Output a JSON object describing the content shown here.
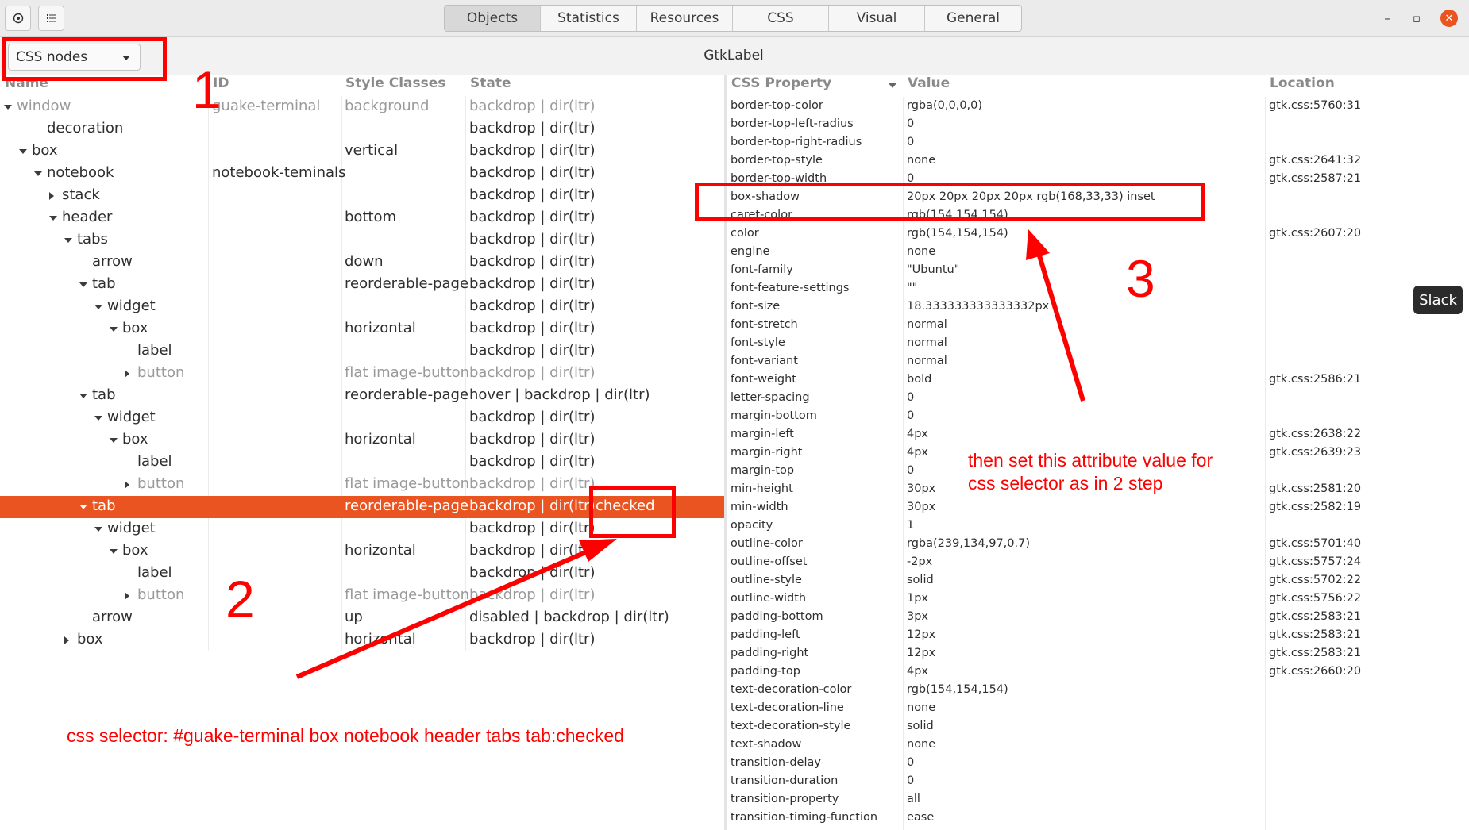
{
  "headerbar": {
    "tabs": [
      {
        "label": "Objects",
        "active": true
      },
      {
        "label": "Statistics",
        "active": false
      },
      {
        "label": "Resources",
        "active": false
      },
      {
        "label": "CSS",
        "active": false
      },
      {
        "label": "Visual",
        "active": false
      },
      {
        "label": "General",
        "active": false
      }
    ],
    "left_buttons": [
      "target-icon",
      "list-icon"
    ],
    "window_controls": [
      "minimize",
      "maximize",
      "close"
    ]
  },
  "subbar": {
    "mode_combo": "CSS nodes",
    "object_title": "GtkLabel"
  },
  "node_tree": {
    "columns": [
      "Name",
      "ID",
      "Style Classes",
      "State"
    ],
    "rows": [
      {
        "name": "window",
        "id": "guake-terminal",
        "classes": "background",
        "state": "backdrop | dir(ltr)",
        "extra": "",
        "expander": "open",
        "dim": true,
        "selected": false
      },
      {
        "name": "decoration",
        "id": "",
        "classes": "",
        "state": "backdrop | dir(ltr)",
        "extra": "",
        "expander": "none",
        "dim": false,
        "selected": false
      },
      {
        "name": "box",
        "id": "",
        "classes": "vertical",
        "state": "backdrop | dir(ltr)",
        "extra": "",
        "expander": "open",
        "dim": false,
        "selected": false
      },
      {
        "name": "notebook",
        "id": "notebook-teminals",
        "classes": "",
        "state": "backdrop | dir(ltr)",
        "extra": "",
        "expander": "open",
        "dim": false,
        "selected": false
      },
      {
        "name": "stack",
        "id": "",
        "classes": "",
        "state": "backdrop | dir(ltr)",
        "extra": "",
        "expander": "closed",
        "dim": false,
        "selected": false
      },
      {
        "name": "header",
        "id": "",
        "classes": "bottom",
        "state": "backdrop | dir(ltr)",
        "extra": "",
        "expander": "open",
        "dim": false,
        "selected": false
      },
      {
        "name": "tabs",
        "id": "",
        "classes": "",
        "state": "backdrop | dir(ltr)",
        "extra": "",
        "expander": "open",
        "dim": false,
        "selected": false
      },
      {
        "name": "arrow",
        "id": "",
        "classes": "down",
        "state": "backdrop | dir(ltr)",
        "extra": "",
        "expander": "none",
        "dim": false,
        "selected": false
      },
      {
        "name": "tab",
        "id": "",
        "classes": "reorderable-page",
        "state": "backdrop | dir(ltr)",
        "extra": "",
        "expander": "open",
        "dim": false,
        "selected": false
      },
      {
        "name": "widget",
        "id": "",
        "classes": "",
        "state": "backdrop | dir(ltr)",
        "extra": "",
        "expander": "open",
        "dim": false,
        "selected": false
      },
      {
        "name": "box",
        "id": "",
        "classes": "horizontal",
        "state": "backdrop | dir(ltr)",
        "extra": "",
        "expander": "open",
        "dim": false,
        "selected": false
      },
      {
        "name": "label",
        "id": "",
        "classes": "",
        "state": "backdrop | dir(ltr)",
        "extra": "",
        "expander": "none",
        "dim": false,
        "selected": false
      },
      {
        "name": "button",
        "id": "",
        "classes": "flat image-button",
        "state": "backdrop | dir(ltr)",
        "extra": "",
        "expander": "closed",
        "dim": true,
        "selected": false
      },
      {
        "name": "tab",
        "id": "",
        "classes": "reorderable-page",
        "state": "hover | backdrop | dir(ltr)",
        "extra": "",
        "expander": "open",
        "dim": false,
        "selected": false
      },
      {
        "name": "widget",
        "id": "",
        "classes": "",
        "state": "backdrop | dir(ltr)",
        "extra": "",
        "expander": "open",
        "dim": false,
        "selected": false
      },
      {
        "name": "box",
        "id": "",
        "classes": "horizontal",
        "state": "backdrop | dir(ltr)",
        "extra": "",
        "expander": "open",
        "dim": false,
        "selected": false
      },
      {
        "name": "label",
        "id": "",
        "classes": "",
        "state": "backdrop | dir(ltr)",
        "extra": "",
        "expander": "none",
        "dim": false,
        "selected": false
      },
      {
        "name": "button",
        "id": "",
        "classes": "flat image-button",
        "state": "backdrop | dir(ltr)",
        "extra": "",
        "expander": "closed",
        "dim": true,
        "selected": false
      },
      {
        "name": "tab",
        "id": "",
        "classes": "reorderable-page",
        "state": "backdrop | dir(ltr)",
        "extra": "checked",
        "expander": "open",
        "dim": false,
        "selected": true
      },
      {
        "name": "widget",
        "id": "",
        "classes": "",
        "state": "backdrop | dir(ltr)",
        "extra": "",
        "expander": "open",
        "dim": false,
        "selected": false
      },
      {
        "name": "box",
        "id": "",
        "classes": "horizontal",
        "state": "backdrop | dir(ltr)",
        "extra": "",
        "expander": "open",
        "dim": false,
        "selected": false
      },
      {
        "name": "label",
        "id": "",
        "classes": "",
        "state": "backdrop | dir(ltr)",
        "extra": "",
        "expander": "none",
        "dim": false,
        "selected": false
      },
      {
        "name": "button",
        "id": "",
        "classes": "flat image-button",
        "state": "backdrop | dir(ltr)",
        "extra": "",
        "expander": "closed",
        "dim": true,
        "selected": false
      },
      {
        "name": "arrow",
        "id": "",
        "classes": "up",
        "state": "disabled | backdrop | dir(ltr)",
        "extra": "",
        "expander": "none",
        "dim": false,
        "selected": false
      },
      {
        "name": "box",
        "id": "",
        "classes": "horizontal",
        "state": "backdrop | dir(ltr)",
        "extra": "",
        "expander": "closed",
        "dim": false,
        "selected": false
      }
    ]
  },
  "properties": {
    "columns": [
      "CSS Property",
      "Value",
      "Location"
    ],
    "rows": [
      {
        "prop": "border-top-color",
        "value": "rgba(0,0,0,0)",
        "loc": "gtk.css:5760:31"
      },
      {
        "prop": "border-top-left-radius",
        "value": "0",
        "loc": ""
      },
      {
        "prop": "border-top-right-radius",
        "value": "0",
        "loc": ""
      },
      {
        "prop": "border-top-style",
        "value": "none",
        "loc": "gtk.css:2641:32"
      },
      {
        "prop": "border-top-width",
        "value": "0",
        "loc": "gtk.css:2587:21"
      },
      {
        "prop": "box-shadow",
        "value": "20px 20px 20px 20px rgb(168,33,33) inset",
        "loc": ""
      },
      {
        "prop": "caret-color",
        "value": "rgb(154,154,154)",
        "loc": ""
      },
      {
        "prop": "color",
        "value": "rgb(154,154,154)",
        "loc": "gtk.css:2607:20"
      },
      {
        "prop": "engine",
        "value": "none",
        "loc": ""
      },
      {
        "prop": "font-family",
        "value": "\"Ubuntu\"",
        "loc": ""
      },
      {
        "prop": "font-feature-settings",
        "value": "\"\"",
        "loc": ""
      },
      {
        "prop": "font-size",
        "value": "18.333333333333332px",
        "loc": ""
      },
      {
        "prop": "font-stretch",
        "value": "normal",
        "loc": ""
      },
      {
        "prop": "font-style",
        "value": "normal",
        "loc": ""
      },
      {
        "prop": "font-variant",
        "value": "normal",
        "loc": ""
      },
      {
        "prop": "font-weight",
        "value": "bold",
        "loc": "gtk.css:2586:21"
      },
      {
        "prop": "letter-spacing",
        "value": "0",
        "loc": ""
      },
      {
        "prop": "margin-bottom",
        "value": "0",
        "loc": ""
      },
      {
        "prop": "margin-left",
        "value": "4px",
        "loc": "gtk.css:2638:22"
      },
      {
        "prop": "margin-right",
        "value": "4px",
        "loc": "gtk.css:2639:23"
      },
      {
        "prop": "margin-top",
        "value": "0",
        "loc": ""
      },
      {
        "prop": "min-height",
        "value": "30px",
        "loc": "gtk.css:2581:20"
      },
      {
        "prop": "min-width",
        "value": "30px",
        "loc": "gtk.css:2582:19"
      },
      {
        "prop": "opacity",
        "value": "1",
        "loc": ""
      },
      {
        "prop": "outline-color",
        "value": "rgba(239,134,97,0.7)",
        "loc": "gtk.css:5701:40"
      },
      {
        "prop": "outline-offset",
        "value": "-2px",
        "loc": "gtk.css:5757:24"
      },
      {
        "prop": "outline-style",
        "value": "solid",
        "loc": "gtk.css:5702:22"
      },
      {
        "prop": "outline-width",
        "value": "1px",
        "loc": "gtk.css:5756:22"
      },
      {
        "prop": "padding-bottom",
        "value": "3px",
        "loc": "gtk.css:2583:21"
      },
      {
        "prop": "padding-left",
        "value": "12px",
        "loc": "gtk.css:2583:21"
      },
      {
        "prop": "padding-right",
        "value": "12px",
        "loc": "gtk.css:2583:21"
      },
      {
        "prop": "padding-top",
        "value": "4px",
        "loc": "gtk.css:2660:20"
      },
      {
        "prop": "text-decoration-color",
        "value": "rgb(154,154,154)",
        "loc": ""
      },
      {
        "prop": "text-decoration-line",
        "value": "none",
        "loc": ""
      },
      {
        "prop": "text-decoration-style",
        "value": "solid",
        "loc": ""
      },
      {
        "prop": "text-shadow",
        "value": "none",
        "loc": ""
      },
      {
        "prop": "transition-delay",
        "value": "0",
        "loc": ""
      },
      {
        "prop": "transition-duration",
        "value": "0",
        "loc": ""
      },
      {
        "prop": "transition-property",
        "value": "all",
        "loc": ""
      },
      {
        "prop": "transition-timing-function",
        "value": "ease",
        "loc": ""
      }
    ]
  },
  "tooltip": "Slack",
  "annotations": {
    "step1": "1",
    "step2": "2",
    "step3": "3",
    "selector_text": "css selector: #guake-terminal box notebook header tabs tab:checked",
    "step3_text_line1": "then set this attribute value for",
    "step3_text_line2": "css selector as in 2 step",
    "color": "#ff0000"
  },
  "colors": {
    "selection": "#e95420",
    "annotation": "#ff0000"
  }
}
